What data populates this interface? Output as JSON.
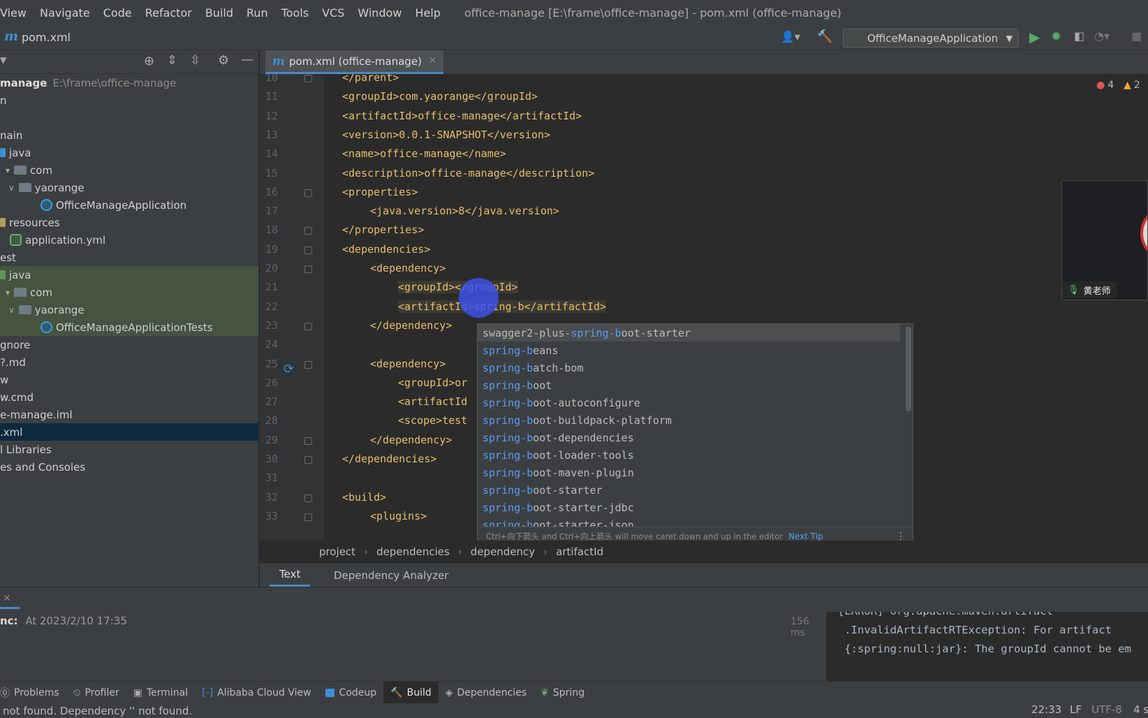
{
  "window_title": "office-manage [E:\\frame\\office-manage] - pom.xml (office-manage)",
  "menu": [
    "View",
    "Navigate",
    "Code",
    "Refactor",
    "Build",
    "Run",
    "Tools",
    "VCS",
    "Window",
    "Help"
  ],
  "nav": {
    "logo": "m",
    "file": "pom.xml",
    "run_config": "OfficeManageApplication"
  },
  "project": {
    "root_name": "manage",
    "root_path": "E:\\frame\\office-manage",
    "items": [
      {
        "label": "n"
      },
      {
        "label": "nain"
      },
      {
        "label": "java"
      },
      {
        "label": "com"
      },
      {
        "label": "yaorange"
      },
      {
        "label": "OfficeManageApplication"
      },
      {
        "label": "resources"
      },
      {
        "label": "application.yml"
      },
      {
        "label": "est"
      },
      {
        "label": "java"
      },
      {
        "label": "com"
      },
      {
        "label": "yaorange"
      },
      {
        "label": "OfficeManageApplicationTests"
      },
      {
        "label": "gnore"
      },
      {
        "label": "?.md"
      },
      {
        "label": "w"
      },
      {
        "label": "w.cmd"
      },
      {
        "label": "e-manage.iml"
      },
      {
        "label": ".xml"
      },
      {
        "label": "l Libraries"
      },
      {
        "label": "es and Consoles"
      }
    ]
  },
  "editor": {
    "tab_label": "pom.xml (office-manage)",
    "problems": {
      "errors": "4",
      "warnings": "2"
    },
    "lines": [
      {
        "n": "10",
        "code": "</parent>"
      },
      {
        "n": "11",
        "code": "<groupId>com.yaorange</groupId>"
      },
      {
        "n": "12",
        "code": "<artifactId>office-manage</artifactId>"
      },
      {
        "n": "13",
        "code": "<version>0.0.1-SNAPSHOT</version>"
      },
      {
        "n": "14",
        "code": "<name>office-manage</name>"
      },
      {
        "n": "15",
        "code": "<description>office-manage</description>"
      },
      {
        "n": "16",
        "code": "<properties>"
      },
      {
        "n": "17",
        "code": "<java.version>8</java.version>"
      },
      {
        "n": "18",
        "code": "</properties>"
      },
      {
        "n": "19",
        "code": "<dependencies>"
      },
      {
        "n": "20",
        "code": "<dependency>"
      },
      {
        "n": "21",
        "code": "<groupId></groupId>"
      },
      {
        "n": "22",
        "code": "<artifactId>spring-b</artifactId>"
      },
      {
        "n": "23",
        "code": "</dependency>"
      },
      {
        "n": "24",
        "code": ""
      },
      {
        "n": "25",
        "code": "<dependency>"
      },
      {
        "n": "26",
        "code": "<groupId>or"
      },
      {
        "n": "27",
        "code": "<artifactId"
      },
      {
        "n": "28",
        "code": "<scope>test"
      },
      {
        "n": "29",
        "code": "</dependency>"
      },
      {
        "n": "30",
        "code": "</dependencies>"
      },
      {
        "n": "31",
        "code": ""
      },
      {
        "n": "32",
        "code": "<build>"
      },
      {
        "n": "33",
        "code": "<plugins>"
      }
    ]
  },
  "autocomplete": {
    "items": [
      {
        "pre": "swagger2-plus-",
        "match": "spring-b",
        "rest": "oot-starter"
      },
      {
        "pre": "",
        "match": "spring-b",
        "rest": "eans"
      },
      {
        "pre": "",
        "match": "spring-b",
        "rest": "atch-bom"
      },
      {
        "pre": "",
        "match": "spring-b",
        "rest": "oot"
      },
      {
        "pre": "",
        "match": "spring-b",
        "rest": "oot-autoconfigure"
      },
      {
        "pre": "",
        "match": "spring-b",
        "rest": "oot-buildpack-platform"
      },
      {
        "pre": "",
        "match": "spring-b",
        "rest": "oot-dependencies"
      },
      {
        "pre": "",
        "match": "spring-b",
        "rest": "oot-loader-tools"
      },
      {
        "pre": "",
        "match": "spring-b",
        "rest": "oot-maven-plugin"
      },
      {
        "pre": "",
        "match": "spring-b",
        "rest": "oot-starter"
      },
      {
        "pre": "",
        "match": "spring-b",
        "rest": "oot-starter-jdbc"
      },
      {
        "pre": "",
        "match": "spring-b",
        "rest": "oot-starter-json"
      }
    ],
    "tip": "Ctrl+向下箭头 and Ctrl+向上箭头 will move caret down and up in the editor",
    "next_tip": "Next Tip"
  },
  "breadcrumb": [
    "project",
    "dependencies",
    "dependency",
    "artifactId"
  ],
  "xml_tabs": [
    "Text",
    "Dependency Analyzer"
  ],
  "build": {
    "sync_label": "nc:",
    "sync_time": "At 2023/2/10 17:35",
    "duration": "156 ms",
    "console": [
      "[ERROR] org.apache.maven.artifact",
      " .InvalidArtifactRTException: For artifact",
      " {:spring:null:jar}: The groupId cannot be em"
    ]
  },
  "tool_windows": [
    "Problems",
    "Profiler",
    "Terminal",
    "Alibaba Cloud View",
    "Codeup",
    "Build",
    "Dependencies",
    "Spring"
  ],
  "status": {
    "message": "not found. Dependency '' not found.",
    "time": "22:33",
    "line_sep": "LF",
    "encoding": "UTF-8",
    "indent": "4 s"
  },
  "webcam": {
    "name": "黄老师"
  },
  "colors": {
    "accent": "#4a88c7",
    "tag": "#e8bf6a",
    "match": "#589df6",
    "error": "#e05555",
    "warning": "#f0a732"
  }
}
